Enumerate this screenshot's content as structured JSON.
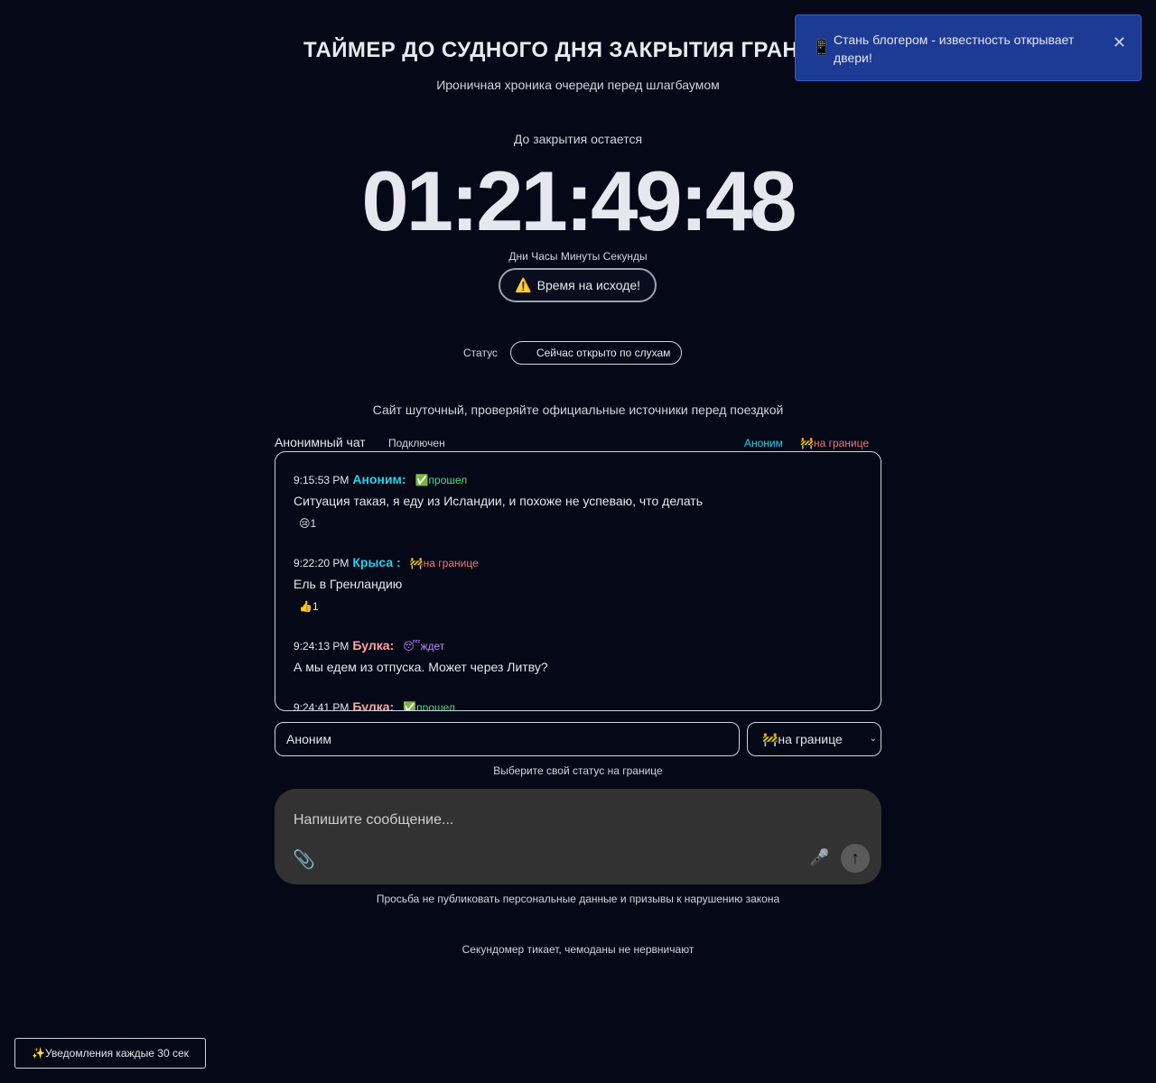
{
  "header": {
    "title": "ТАЙМЕР ДО СУДНОГО ДНЯ ЗАКРЫТИЯ ГРАН",
    "subtitle": "Ироничная хроника очереди перед шлагбаумом"
  },
  "countdown": {
    "label": "До закрытия остается",
    "value": "01:21:49:48",
    "units": "Дни Часы Минуты Секунды",
    "alert_icon": "⚠️",
    "alert_text": "Время на исходе!"
  },
  "status": {
    "label": "Статус",
    "value": "Сейчас открыто по слухам"
  },
  "disclaimer": "Сайт шуточный, проверяйте официальные источники перед поездкой",
  "chat": {
    "title": "Анонимный чат",
    "connection": "Подключен",
    "current_user": "Аноним",
    "current_status": "🚧на границе",
    "messages": [
      {
        "time": "9:15:53 PM",
        "name": "Аноним:",
        "name_color": "#22d3ee",
        "badge": "✅прошел",
        "badge_color": "#4ade80",
        "text": "Ситуация такая, я еду из Исландии, и похоже не успеваю, что делать",
        "reaction": "😢1"
      },
      {
        "time": "9:22:20 PM",
        "name": "Крыса :",
        "name_color": "#22d3ee",
        "badge": "🚧на границе",
        "badge_color": "#f87171",
        "text": "Ель в Гренландию",
        "reaction": "👍1"
      },
      {
        "time": "9:24:13 PM",
        "name": "Булка:",
        "name_color": "#fca5a5",
        "badge": "😴ждет",
        "badge_color": "#c084fc",
        "text": "А мы едем из отпуска. Может через Литву?",
        "reaction": ""
      },
      {
        "time": "9:24:41 PM",
        "name": "Булка:",
        "name_color": "#fca5a5",
        "badge": "✅прошел",
        "badge_color": "#4ade80",
        "text": "",
        "reaction": ""
      }
    ]
  },
  "form": {
    "name_value": "Аноним",
    "status_selected": "🚧на границе",
    "status_hint": "Выберите свой статус на границе",
    "message_placeholder": "Напишите сообщение...",
    "privacy_note": "Просьба не публиковать персональные данные и призывы к нарушению закона"
  },
  "footer": "Секундомер тикает, чемоданы не нервничают",
  "notifications_button": "✨Уведомления каждые 30 сек",
  "toast": {
    "icon": "📱",
    "text": "Стань блогером - известность открывает двери!",
    "close": "✕"
  },
  "colors": {
    "background": "#050816",
    "toast": "#1d3a94",
    "accent_cyan": "#22d3ee"
  }
}
